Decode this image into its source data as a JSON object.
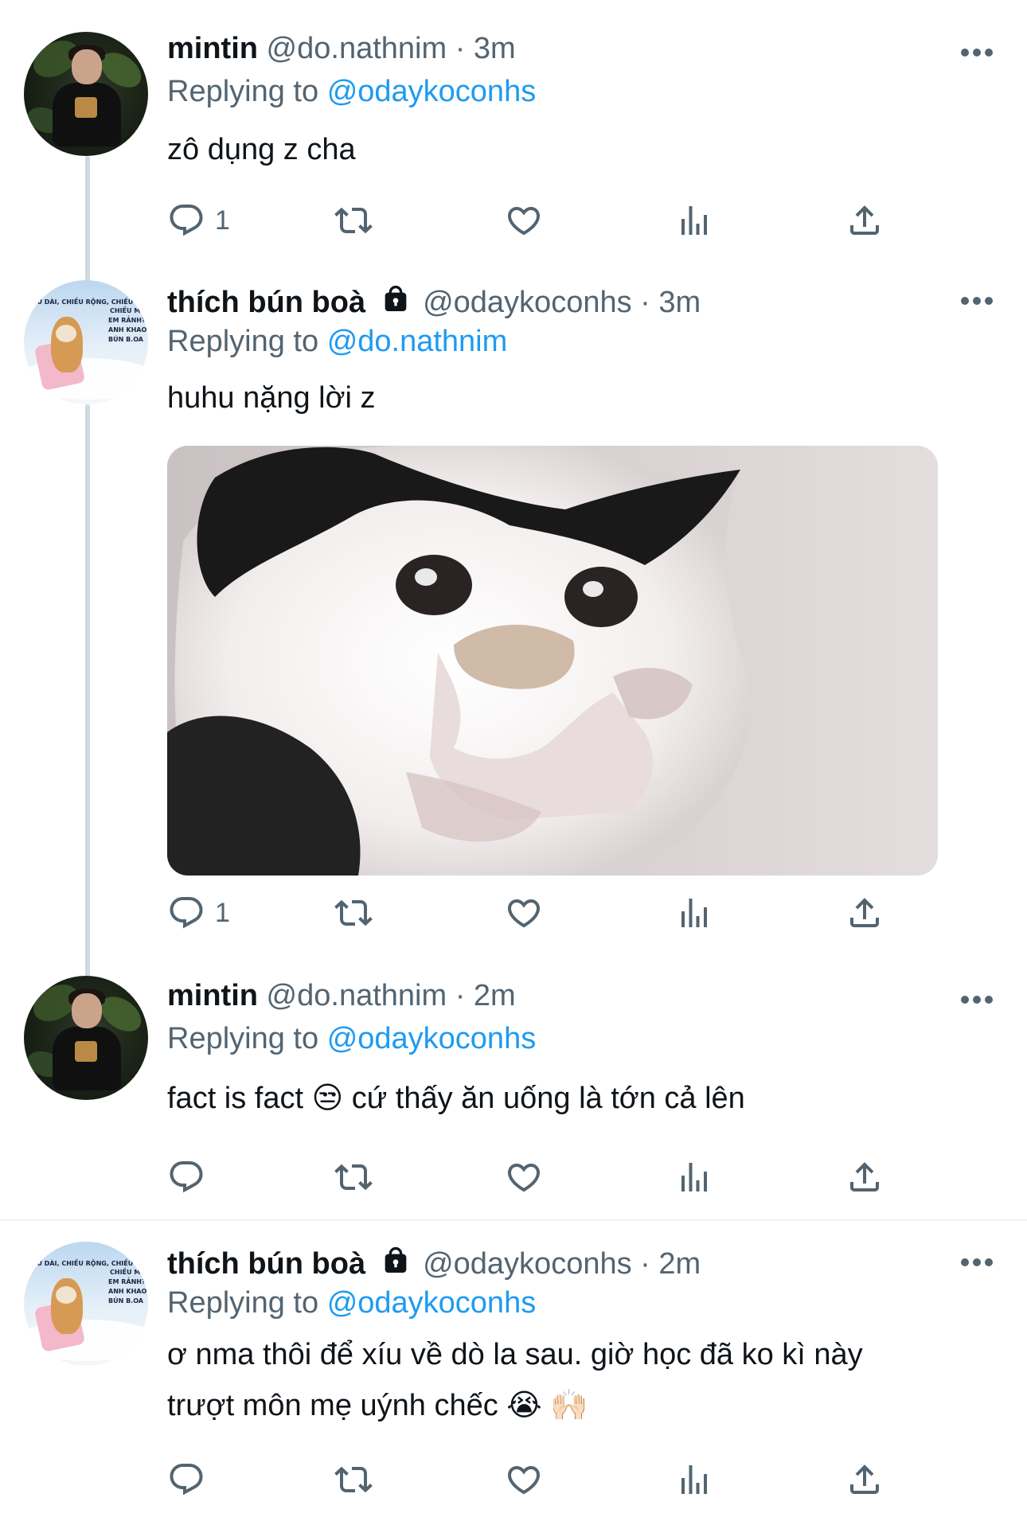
{
  "tweets": [
    {
      "display_name": "mintin",
      "handle": "@do.nathnim",
      "time": "· 3m",
      "replying_prefix": "Replying to",
      "replying_to": "@odaykoconhs",
      "text": "zô dụng z cha",
      "reply_count": "1",
      "locked": false
    },
    {
      "display_name": "thích bún boà",
      "handle": "@odaykoconhs",
      "time": "· 3m",
      "replying_prefix": "Replying to",
      "replying_to": "@do.nathnim",
      "text": "huhu nặng lời z",
      "reply_count": "1",
      "locked": true,
      "has_image": true
    },
    {
      "display_name": "mintin",
      "handle": "@do.nathnim",
      "time": "· 2m",
      "replying_prefix": "Replying to",
      "replying_to": "@odaykoconhs",
      "text": "fact is fact 😒  cứ thấy ăn uống là tớn cả lên",
      "reply_count": "",
      "locked": false
    },
    {
      "display_name": "thích bún boà",
      "handle": "@odaykoconhs",
      "time": "· 2m",
      "replying_prefix": "Replying to",
      "replying_to": "@odaykoconhs",
      "text_line1": "ơ nma thôi để xíu về dò la sau. giờ học đã ko kì này",
      "text_line2": "trượt môn mẹ uýnh chếc 😭 🙌🏻",
      "reply_count": "",
      "locked": true
    }
  ],
  "avatar_dog_text": [
    "IỀU DÀI, CHIỀU RỘNG, CHIỀU C",
    "CHIỀU MA",
    "EM RẢNH?",
    "ANH KHAO",
    "BÚN B.OA"
  ],
  "icons": [
    "reply-icon",
    "retweet-icon",
    "like-icon",
    "views-icon",
    "share-icon",
    "more-icon",
    "lock-icon"
  ],
  "colors": {
    "text": "#0f1419",
    "secondary": "#536471",
    "link": "#1d9bf0",
    "thread": "#cfd9de"
  }
}
